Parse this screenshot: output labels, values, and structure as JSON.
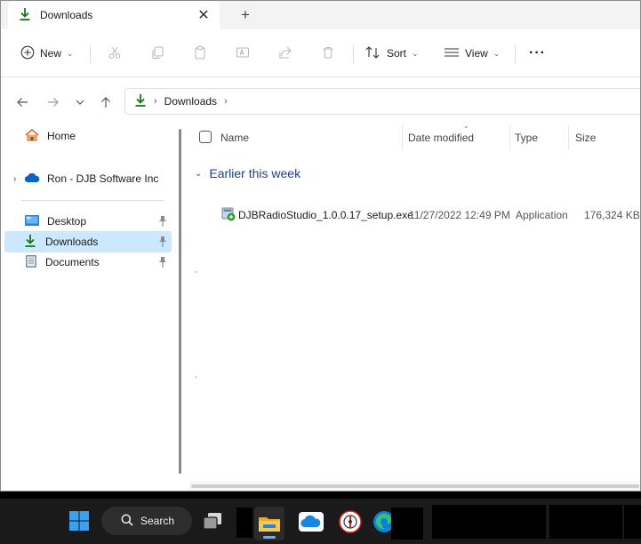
{
  "window": {
    "tab_title": "Downloads",
    "tab_close_glyph": "✕",
    "new_tab_glyph": "+"
  },
  "toolbar": {
    "new_label": "New",
    "sort_label": "Sort",
    "view_label": "View",
    "more_glyph": "···",
    "disabled_icons": [
      "cut-icon",
      "copy-icon",
      "paste-icon",
      "rename-icon",
      "share-icon",
      "delete-icon"
    ]
  },
  "address": {
    "crumbs": [
      "Downloads"
    ]
  },
  "sidebar": {
    "items": [
      {
        "label": "Home",
        "icon": "home-icon"
      },
      {
        "label": "Ron - DJB Software Inc",
        "icon": "onedrive-cloud-icon"
      },
      {
        "label": "Desktop",
        "icon": "desktop-folder-icon",
        "pinned": true
      },
      {
        "label": "Downloads",
        "icon": "downloads-icon",
        "pinned": true,
        "selected": true
      },
      {
        "label": "Documents",
        "icon": "documents-icon",
        "pinned": true
      }
    ]
  },
  "columns": {
    "name": "Name",
    "date_modified": "Date modified",
    "type": "Type",
    "size": "Size"
  },
  "groups": [
    {
      "label": "Earlier this week",
      "files": [
        {
          "name": "DJBRadioStudio_1.0.0.17_setup.exe",
          "date_modified": "11/27/2022 12:49 PM",
          "type": "Application",
          "size": "176,324 KB",
          "icon": "installer-exe-icon"
        }
      ]
    }
  ],
  "taskbar": {
    "search_label": "Search",
    "apps": [
      "windows-start-icon",
      "task-view-icon",
      "file-explorer-icon",
      "onedrive-icon",
      "radio-app-icon",
      "edge-icon"
    ]
  },
  "colors": {
    "accent": "#0f7b0f",
    "selection": "#cce8ff",
    "group_heading": "#1f3f8a",
    "taskbar": "#1a1a1a"
  }
}
